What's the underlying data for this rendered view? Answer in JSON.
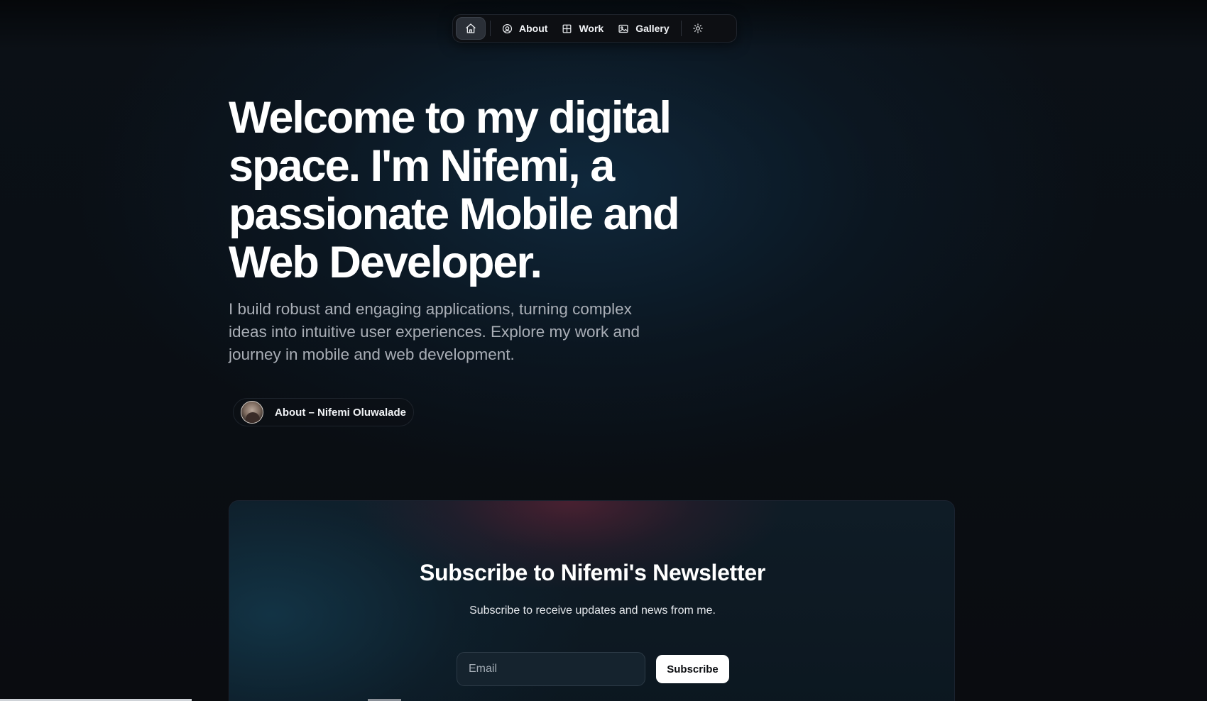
{
  "nav": {
    "home_icon": "home-icon",
    "items": [
      {
        "label": "About",
        "icon": "user-circle-icon"
      },
      {
        "label": "Work",
        "icon": "grid-icon"
      },
      {
        "label": "Gallery",
        "icon": "image-icon"
      }
    ],
    "theme_icon": "sun-icon"
  },
  "hero": {
    "title": "Welcome to my digital space. I'm Nifemi, a passionate Mobile and Web Developer.",
    "subtitle": "I build robust and engaging applications, turning complex ideas into intuitive user experiences. Explore my work and journey in mobile and web development.",
    "about_link": "About – Nifemi Oluwalade"
  },
  "newsletter": {
    "title": "Subscribe to Nifemi's Newsletter",
    "subtitle": "Subscribe to receive updates and news from me.",
    "email_placeholder": "Email",
    "button_label": "Subscribe"
  },
  "colors": {
    "background": "#0a0d12",
    "text_primary": "#ffffff",
    "text_secondary": "#a9aeb6",
    "card_accent": "#78243a",
    "button_bg": "#ffffff"
  }
}
